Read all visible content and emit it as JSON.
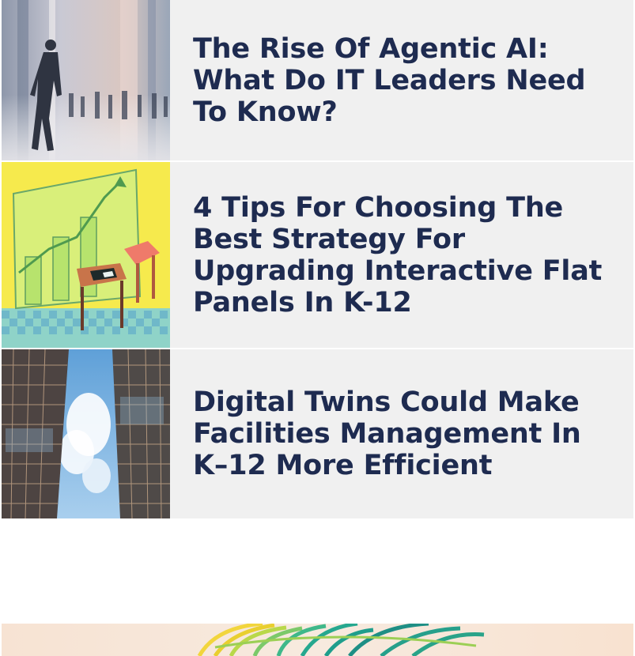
{
  "articles": [
    {
      "title": "The Rise Of Agentic AI: What Do IT Leaders Need To Know?",
      "thumbnail": "businessman-walking-crowd-image"
    },
    {
      "title": "4 Tips For Choosing The Best Strategy For Upgrading Interactive Flat Panels In K-12",
      "thumbnail": "growth-chart-and-chair-illustration"
    },
    {
      "title": "Digital Twins Could Make Facilities Management In K–12 More Efficient",
      "thumbnail": "skyscrapers-looking-up-image"
    }
  ],
  "promo": {
    "thumbnail": "colorful-globe-graphic"
  },
  "colors": {
    "card_background": "#f0f0f0",
    "title_text": "#1e2b50",
    "page_background": "#ffffff"
  }
}
